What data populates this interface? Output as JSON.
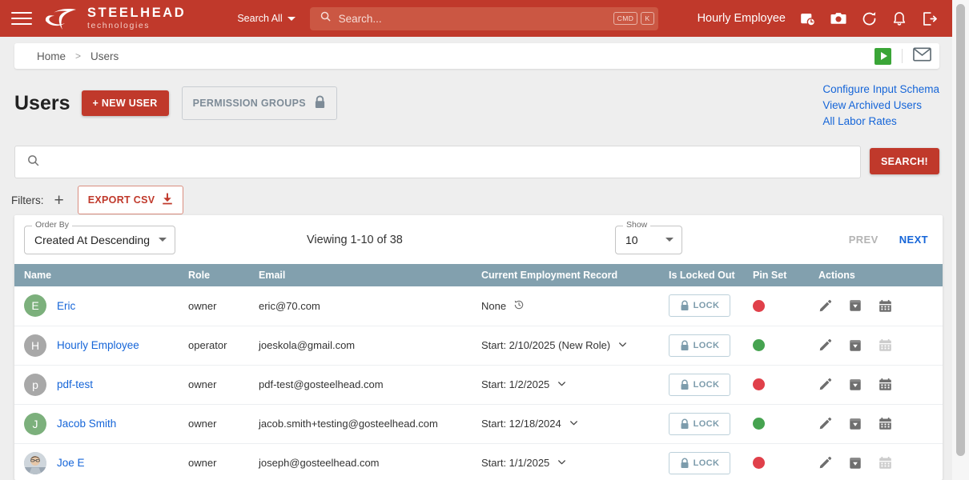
{
  "header": {
    "brand_title": "STEELHEAD",
    "brand_sub": "technologies",
    "search_scope": "Search All",
    "search_placeholder": "Search...",
    "kbd_mod": "CMD",
    "kbd_key": "K",
    "user_name": "Hourly Employee",
    "bg_color": "#c0392b",
    "icons": [
      "menu-icon",
      "calendar-clock-icon",
      "camera-icon",
      "refresh-icon",
      "bell-icon",
      "logout-icon"
    ]
  },
  "breadcrumb": {
    "home": "Home",
    "separator": ">",
    "current": "Users"
  },
  "title_row": {
    "heading": "Users",
    "new_user_label": "+ NEW USER",
    "permission_groups_label": "PERMISSION GROUPS"
  },
  "quick_links": [
    {
      "label": "Configure Input Schema"
    },
    {
      "label": "View Archived Users"
    },
    {
      "label": "All Labor Rates"
    }
  ],
  "search_panel": {
    "value": "",
    "placeholder": "",
    "button_label": "SEARCH!",
    "filters_label": "Filters:",
    "add_filter_label": "+",
    "export_label": "EXPORT CSV"
  },
  "toolbar": {
    "order_by_legend": "Order By",
    "order_by_value": "Created At Descending",
    "viewing": "Viewing 1-10 of 38",
    "show_legend": "Show",
    "show_value": "10",
    "prev_label": "PREV",
    "next_label": "NEXT"
  },
  "table": {
    "columns": [
      "Name",
      "Role",
      "Email",
      "Current Employment Record",
      "Is Locked Out",
      "Pin Set",
      "Actions"
    ],
    "lock_label": "LOCK",
    "rows": [
      {
        "name": "Eric",
        "avatar_initial": "E",
        "avatar_color": "#7cb07c",
        "avatar_type": "initial",
        "role": "owner",
        "email": "eric@70.com",
        "employment": "None",
        "employment_icon": "history-icon",
        "has_chevron": false,
        "pin_set": false,
        "pin_color": "#e0404a",
        "calendar_enabled": true
      },
      {
        "name": "Hourly Employee",
        "avatar_initial": "H",
        "avatar_color": "#a8a8a8",
        "avatar_type": "initial",
        "role": "operator",
        "email": "joeskola@gmail.com",
        "employment": "Start: 2/10/2025 (New Role)",
        "employment_icon": "",
        "has_chevron": true,
        "pin_set": true,
        "pin_color": "#46a350",
        "calendar_enabled": false
      },
      {
        "name": "pdf-test",
        "avatar_initial": "p",
        "avatar_color": "#a8a8a8",
        "avatar_type": "initial",
        "role": "owner",
        "email": "pdf-test@gosteelhead.com",
        "employment": "Start: 1/2/2025",
        "employment_icon": "",
        "has_chevron": true,
        "pin_set": false,
        "pin_color": "#e0404a",
        "calendar_enabled": true
      },
      {
        "name": "Jacob Smith",
        "avatar_initial": "J",
        "avatar_color": "#7cb07c",
        "avatar_type": "initial",
        "role": "owner",
        "email": "jacob.smith+testing@gosteelhead.com",
        "employment": "Start: 12/18/2024",
        "employment_icon": "",
        "has_chevron": true,
        "pin_set": true,
        "pin_color": "#46a350",
        "calendar_enabled": true
      },
      {
        "name": "Joe E",
        "avatar_initial": "",
        "avatar_color": "#b8bfc6",
        "avatar_type": "photo",
        "role": "owner",
        "email": "joseph@gosteelhead.com",
        "employment": "Start: 1/1/2025",
        "employment_icon": "",
        "has_chevron": true,
        "pin_set": false,
        "pin_color": "#e0404a",
        "calendar_enabled": false
      }
    ]
  }
}
